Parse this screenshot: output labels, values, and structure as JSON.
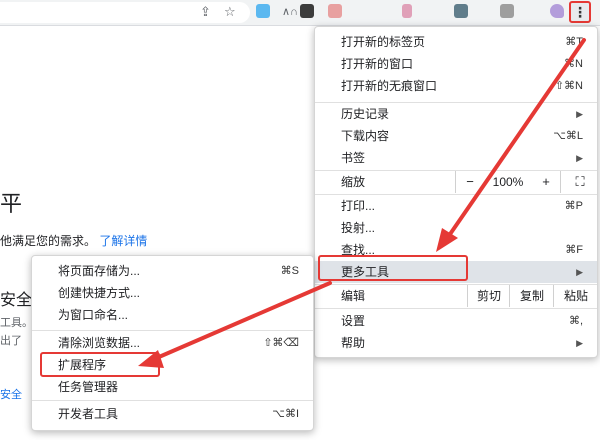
{
  "toolbar": {
    "share_icon": "share-icon",
    "star_icon": "star-icon",
    "menu_icon": "⋮",
    "ext_colors": [
      "#5bb8f0",
      "#3c3c3c",
      "#e8a0a0",
      "#e0a0b8",
      "#607d8b",
      "#9e9e9e",
      "#b39ddb"
    ]
  },
  "page": {
    "title_fragment": "平",
    "desc_fragment": "他满足您的需求。",
    "learn_more": "了解详情",
    "section_fragment": "安全",
    "line1_fragment": "工具。",
    "line2_fragment": "出了",
    "link_fragment": "安全"
  },
  "main_menu": {
    "new_tab": "打开新的标签页",
    "new_tab_sc": "⌘T",
    "new_window": "打开新的窗口",
    "new_window_sc": "⌘N",
    "incognito": "打开新的无痕窗口",
    "incognito_sc": "⇧⌘N",
    "history": "历史记录",
    "downloads": "下载内容",
    "downloads_sc": "⌥⌘L",
    "bookmarks": "书签",
    "zoom": "缩放",
    "zoom_minus": "−",
    "zoom_level": "100%",
    "zoom_plus": "+",
    "fullscreen": "⛶",
    "print": "打印...",
    "print_sc": "⌘P",
    "cast": "投射...",
    "find": "查找...",
    "find_sc": "⌘F",
    "more_tools": "更多工具",
    "edit": "编辑",
    "cut": "剪切",
    "copy": "复制",
    "paste": "粘贴",
    "settings": "设置",
    "settings_sc": "⌘,",
    "help": "帮助",
    "arrow": "▶"
  },
  "sub_menu": {
    "save_page": "将页面存储为...",
    "save_page_sc": "⌘S",
    "create_shortcut": "创建快捷方式...",
    "name_window": "为窗口命名...",
    "clear_data": "清除浏览数据...",
    "clear_data_sc": "⇧⌘⌫",
    "extensions": "扩展程序",
    "task_manager": "任务管理器",
    "dev_tools": "开发者工具",
    "dev_tools_sc": "⌥⌘I"
  },
  "annotation": {
    "color": "#e53935"
  }
}
